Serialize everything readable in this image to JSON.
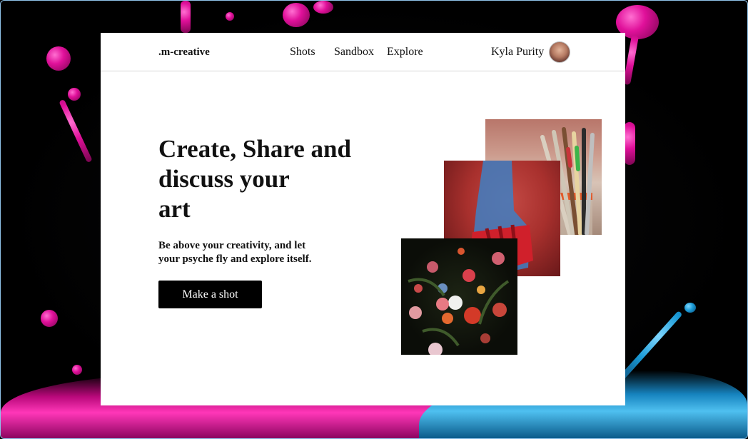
{
  "header": {
    "logo": ".m-creative",
    "nav": [
      "Shots",
      "Sandbox",
      "Explore"
    ],
    "user_name": "Kyla Purity"
  },
  "hero": {
    "headline_line1": "Create, Share and",
    "headline_line2": "discuss your",
    "headline_line3": "art",
    "subtext_line1": "Be above your creativity, and let",
    "subtext_line2": "your psyche fly and explore itself.",
    "cta_label": "Make a shot"
  },
  "colors": {
    "accent": "#000000",
    "card_background": "#ffffff",
    "splash_pink": "#e0109a",
    "splash_blue": "#1a9ad6"
  }
}
